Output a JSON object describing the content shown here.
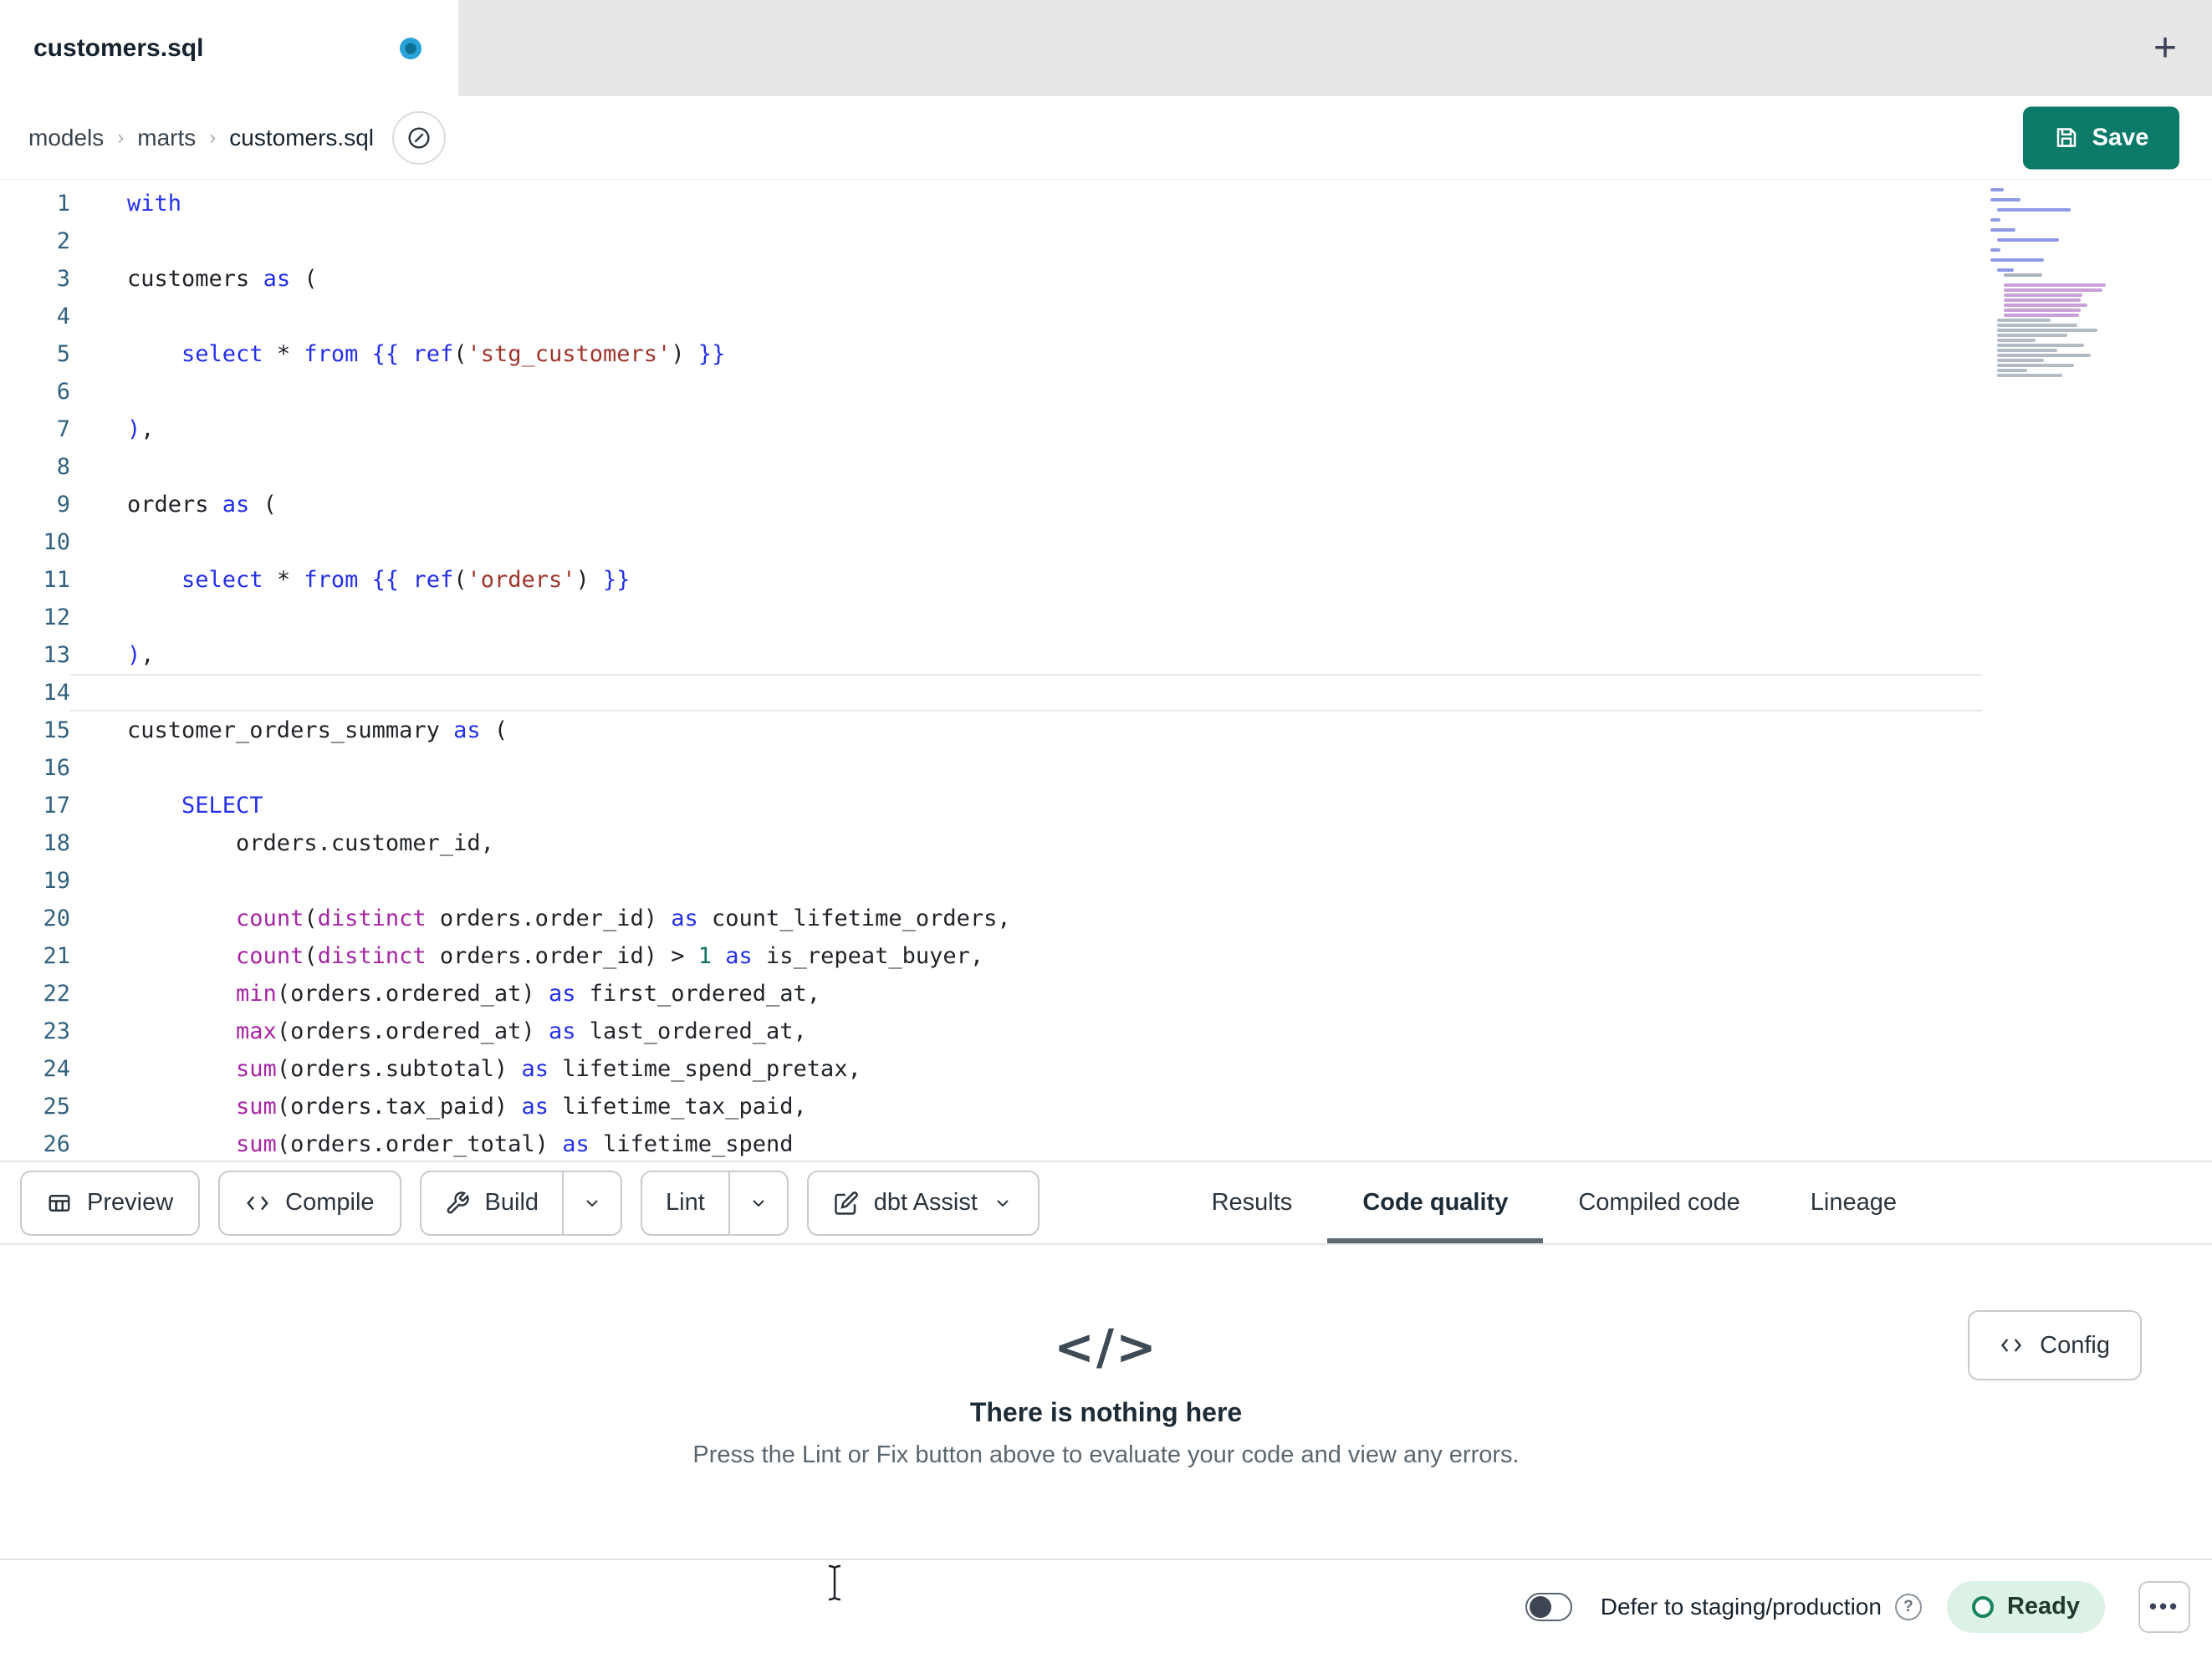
{
  "tab_bar": {
    "active_tab": "customers.sql",
    "new_tab": "+"
  },
  "breadcrumb": {
    "items": [
      "models",
      "marts",
      "customers.sql"
    ],
    "separator": "›"
  },
  "save": {
    "label": "Save"
  },
  "toolbar": {
    "preview": "Preview",
    "compile": "Compile",
    "build": "Build",
    "lint": "Lint",
    "assist": "dbt Assist"
  },
  "panel_tabs": [
    {
      "label": "Results",
      "active": false
    },
    {
      "label": "Code quality",
      "active": true
    },
    {
      "label": "Compiled code",
      "active": false
    },
    {
      "label": "Lineage",
      "active": false
    }
  ],
  "config": {
    "label": "Config",
    "icon_glyph": "</>"
  },
  "empty": {
    "icon_glyph": "</>",
    "title": "There is nothing here",
    "subtitle": "Press the Lint or Fix button above to evaluate your code and view any errors."
  },
  "status": {
    "defer_label": "Defer to staging/production",
    "help": "?",
    "ready_label": "Ready",
    "more": "•••"
  },
  "colors": {
    "save_button": "#0c7a68",
    "ready_pill_bg": "#dcf2e6",
    "ready_ring": "#17855a",
    "keyword": "#2430e8",
    "function": "#a626a4",
    "string": "#a0352c",
    "number": "#0f7265",
    "line_number": "#33627f",
    "unsaved_dot": "#29a3d7"
  },
  "icons": {
    "save": "floppy-disk",
    "preview": "table-grid",
    "compile": "code-brackets",
    "build": "wrench",
    "assist": "square-pencil",
    "dropdown": "chevron-down",
    "crumb_action": "circle-slash",
    "help": "question-circle",
    "more": "ellipsis"
  },
  "editor": {
    "lines": [
      {
        "n": 1,
        "t": [
          [
            "kw",
            "with"
          ]
        ]
      },
      {
        "n": 2,
        "t": []
      },
      {
        "n": 3,
        "t": [
          [
            "pl",
            "customers "
          ],
          [
            "kw",
            "as"
          ],
          [
            "pl",
            " ("
          ]
        ]
      },
      {
        "n": 4,
        "t": []
      },
      {
        "n": 5,
        "t": [
          [
            "pl",
            "    "
          ],
          [
            "kw",
            "select"
          ],
          [
            "pl",
            " * "
          ],
          [
            "kw",
            "from"
          ],
          [
            "pl",
            " "
          ],
          [
            "kw",
            "{{"
          ],
          [
            "pl",
            " "
          ],
          [
            "kw",
            "ref"
          ],
          [
            "pl",
            "("
          ],
          [
            "str",
            "'stg_customers'"
          ],
          [
            "pl",
            ") "
          ],
          [
            "kw",
            "}}"
          ]
        ]
      },
      {
        "n": 6,
        "t": []
      },
      {
        "n": 7,
        "t": [
          [
            "kw",
            ")"
          ],
          [
            "pl",
            ","
          ]
        ]
      },
      {
        "n": 8,
        "t": []
      },
      {
        "n": 9,
        "t": [
          [
            "pl",
            "orders "
          ],
          [
            "kw",
            "as"
          ],
          [
            "pl",
            " ("
          ]
        ]
      },
      {
        "n": 10,
        "t": []
      },
      {
        "n": 11,
        "t": [
          [
            "pl",
            "    "
          ],
          [
            "kw",
            "select"
          ],
          [
            "pl",
            " * "
          ],
          [
            "kw",
            "from"
          ],
          [
            "pl",
            " "
          ],
          [
            "kw",
            "{{"
          ],
          [
            "pl",
            " "
          ],
          [
            "kw",
            "ref"
          ],
          [
            "pl",
            "("
          ],
          [
            "str",
            "'orders'"
          ],
          [
            "pl",
            ") "
          ],
          [
            "kw",
            "}}"
          ]
        ]
      },
      {
        "n": 12,
        "t": []
      },
      {
        "n": 13,
        "t": [
          [
            "kw",
            ")"
          ],
          [
            "pl",
            ","
          ]
        ]
      },
      {
        "n": 14,
        "t": [],
        "cursor": true
      },
      {
        "n": 15,
        "t": [
          [
            "pl",
            "customer_orders_summary "
          ],
          [
            "kw",
            "as"
          ],
          [
            "pl",
            " ("
          ]
        ]
      },
      {
        "n": 16,
        "t": []
      },
      {
        "n": 17,
        "t": [
          [
            "pl",
            "    "
          ],
          [
            "kw",
            "SELECT"
          ]
        ]
      },
      {
        "n": 18,
        "t": [
          [
            "pl",
            "        orders.customer_id,"
          ]
        ]
      },
      {
        "n": 19,
        "t": []
      },
      {
        "n": 20,
        "t": [
          [
            "pl",
            "        "
          ],
          [
            "fn",
            "count"
          ],
          [
            "pl",
            "("
          ],
          [
            "fn",
            "distinct"
          ],
          [
            "pl",
            " orders.order_id) "
          ],
          [
            "kw",
            "as"
          ],
          [
            "pl",
            " count_lifetime_orders,"
          ]
        ]
      },
      {
        "n": 21,
        "t": [
          [
            "pl",
            "        "
          ],
          [
            "fn",
            "count"
          ],
          [
            "pl",
            "("
          ],
          [
            "fn",
            "distinct"
          ],
          [
            "pl",
            " orders.order_id) > "
          ],
          [
            "num",
            "1"
          ],
          [
            "pl",
            " "
          ],
          [
            "kw",
            "as"
          ],
          [
            "pl",
            " is_repeat_buyer,"
          ]
        ]
      },
      {
        "n": 22,
        "t": [
          [
            "pl",
            "        "
          ],
          [
            "fn",
            "min"
          ],
          [
            "pl",
            "(orders.ordered_at) "
          ],
          [
            "kw",
            "as"
          ],
          [
            "pl",
            " first_ordered_at,"
          ]
        ]
      },
      {
        "n": 23,
        "t": [
          [
            "pl",
            "        "
          ],
          [
            "fn",
            "max"
          ],
          [
            "pl",
            "(orders.ordered_at) "
          ],
          [
            "kw",
            "as"
          ],
          [
            "pl",
            " last_ordered_at,"
          ]
        ]
      },
      {
        "n": 24,
        "t": [
          [
            "pl",
            "        "
          ],
          [
            "fn",
            "sum"
          ],
          [
            "pl",
            "(orders.subtotal) "
          ],
          [
            "kw",
            "as"
          ],
          [
            "pl",
            " lifetime_spend_pretax,"
          ]
        ]
      },
      {
        "n": 25,
        "t": [
          [
            "pl",
            "        "
          ],
          [
            "fn",
            "sum"
          ],
          [
            "pl",
            "(orders.tax_paid) "
          ],
          [
            "kw",
            "as"
          ],
          [
            "pl",
            " lifetime_tax_paid,"
          ]
        ]
      },
      {
        "n": 26,
        "t": [
          [
            "pl",
            "        "
          ],
          [
            "fn",
            "sum"
          ],
          [
            "pl",
            "(orders.order_total) "
          ],
          [
            "kw",
            "as"
          ],
          [
            "pl",
            " lifetime_spend"
          ]
        ]
      }
    ]
  }
}
